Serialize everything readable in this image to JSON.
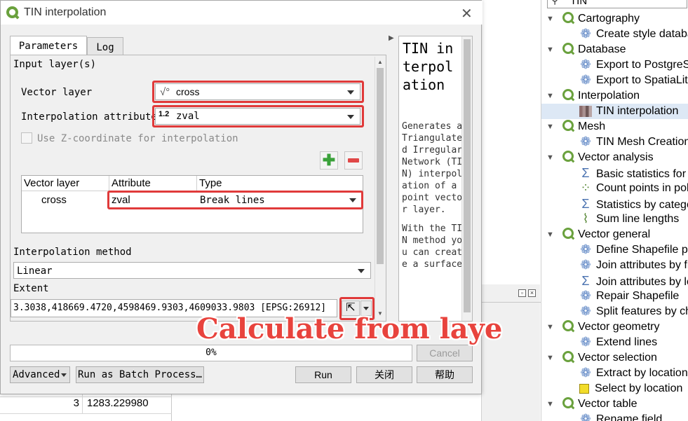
{
  "background": {
    "table_rows": [
      {
        "index": "3",
        "value": "1283.229980"
      }
    ]
  },
  "tree": {
    "search_value": "TIN",
    "items": [
      {
        "kind": "group",
        "label": "Cartography"
      },
      {
        "kind": "alg",
        "icon": "cog",
        "label": "Create style database"
      },
      {
        "kind": "group",
        "label": "Database"
      },
      {
        "kind": "alg",
        "icon": "cog",
        "label": "Export to PostgreSQL"
      },
      {
        "kind": "alg",
        "icon": "cog",
        "label": "Export to SpatiaLite"
      },
      {
        "kind": "group",
        "label": "Interpolation"
      },
      {
        "kind": "alg",
        "icon": "raster",
        "label": "TIN interpolation",
        "selected": true
      },
      {
        "kind": "group",
        "label": "Mesh"
      },
      {
        "kind": "alg",
        "icon": "cog",
        "label": "TIN Mesh Creation"
      },
      {
        "kind": "group",
        "label": "Vector analysis"
      },
      {
        "kind": "alg",
        "icon": "sigma",
        "label": "Basic statistics for fields"
      },
      {
        "kind": "alg",
        "icon": "points",
        "label": "Count points in polygon"
      },
      {
        "kind": "alg",
        "icon": "sigma",
        "label": "Statistics by categories"
      },
      {
        "kind": "alg",
        "icon": "lines",
        "label": "Sum line lengths"
      },
      {
        "kind": "group",
        "label": "Vector general"
      },
      {
        "kind": "alg",
        "icon": "cog",
        "label": "Define Shapefile projection"
      },
      {
        "kind": "alg",
        "icon": "cog",
        "label": "Join attributes by field value"
      },
      {
        "kind": "alg",
        "icon": "sigma",
        "label": "Join attributes by location"
      },
      {
        "kind": "alg",
        "icon": "cog",
        "label": "Repair Shapefile"
      },
      {
        "kind": "alg",
        "icon": "cog",
        "label": "Split features by character"
      },
      {
        "kind": "group",
        "label": "Vector geometry"
      },
      {
        "kind": "alg",
        "icon": "cog",
        "label": "Extend lines"
      },
      {
        "kind": "group",
        "label": "Vector selection"
      },
      {
        "kind": "alg",
        "icon": "cog",
        "label": "Extract by location"
      },
      {
        "kind": "alg",
        "icon": "select",
        "label": "Select by location"
      },
      {
        "kind": "group",
        "label": "Vector table"
      },
      {
        "kind": "alg",
        "icon": "cog",
        "label": "Rename field"
      }
    ]
  },
  "dialog": {
    "title": "TIN interpolation",
    "tabs": {
      "parameters": "Parameters",
      "log": "Log"
    },
    "input_layers_label": "Input layer(s)",
    "vector_layer_label": "Vector layer",
    "vector_layer_value": "cross",
    "interp_attr_label": "Interpolation attribute",
    "interp_attr_badge": "1.2",
    "interp_attr_value": "zval",
    "use_z_label": "Use Z-coordinate for interpolation",
    "table": {
      "headers": [
        "Vector layer",
        "Attribute",
        "Type"
      ],
      "rows": [
        {
          "layer": "cross",
          "attribute": "zval",
          "type": "Break lines"
        }
      ]
    },
    "interp_method_label": "Interpolation method",
    "interp_method_value": "Linear",
    "extent_label": "Extent",
    "extent_value": "3.3038,418669.4720,4598469.9303,4609033.9803 [EPSG:26912]",
    "progress_text": "0%",
    "buttons": {
      "cancel": "Cancel",
      "advanced": "Advanced",
      "batch": "Run as Batch Process…",
      "run": "Run",
      "close": "关闭",
      "help": "帮助"
    },
    "help": {
      "title": "TIN interpolation",
      "body": "Generates a Triangulated Irregular Network (TIN) interpolation of a point vector layer.",
      "body2": "With the TIN method you can create a surface"
    }
  },
  "annotation": "Calculate from laye",
  "colors": {
    "highlight": "#e03a3a",
    "qgis_green": "#6aa13d"
  }
}
